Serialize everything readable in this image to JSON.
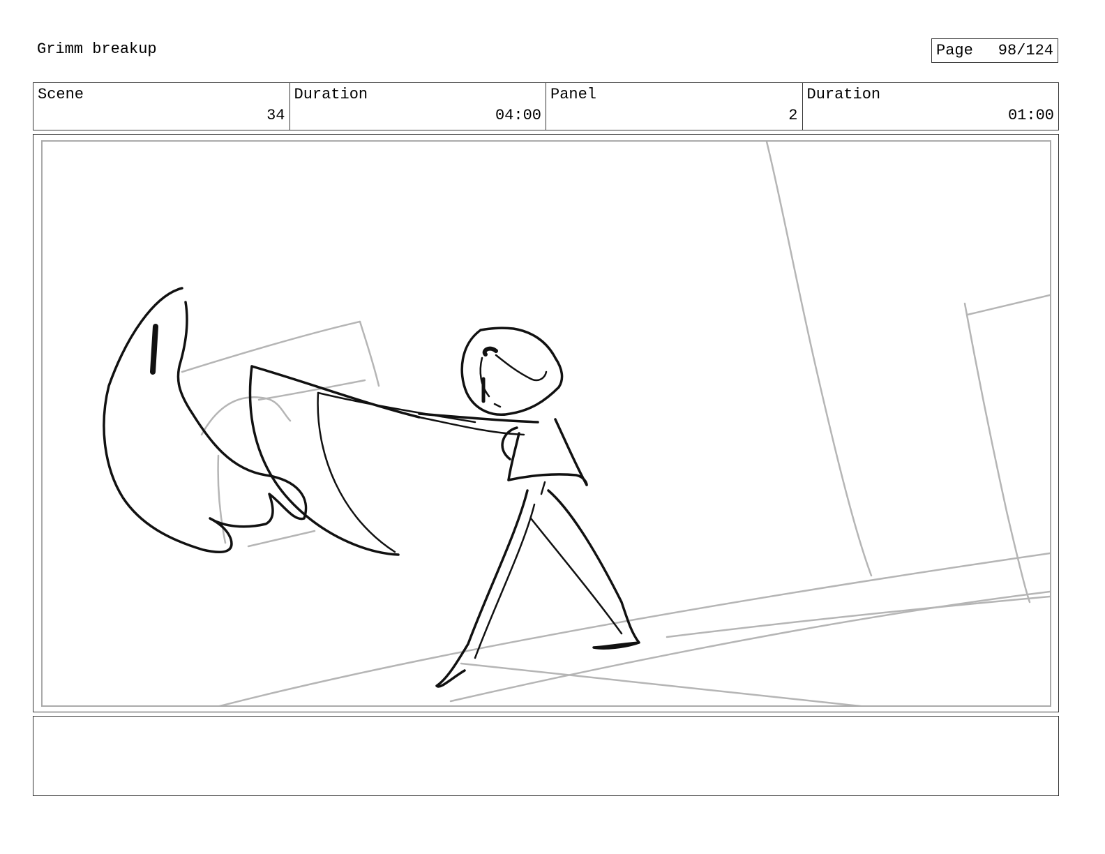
{
  "document": {
    "title": "Grimm breakup"
  },
  "page": {
    "label": "Page",
    "number": "98/124"
  },
  "info": {
    "scene_label": "Scene",
    "scene_value": "34",
    "duration_label": "Duration",
    "duration_value": "04:00",
    "panel_label": "Panel",
    "panel_value": "2",
    "panel_duration_label": "Duration",
    "panel_duration_value": "01:00"
  },
  "notes": {
    "text": ""
  }
}
